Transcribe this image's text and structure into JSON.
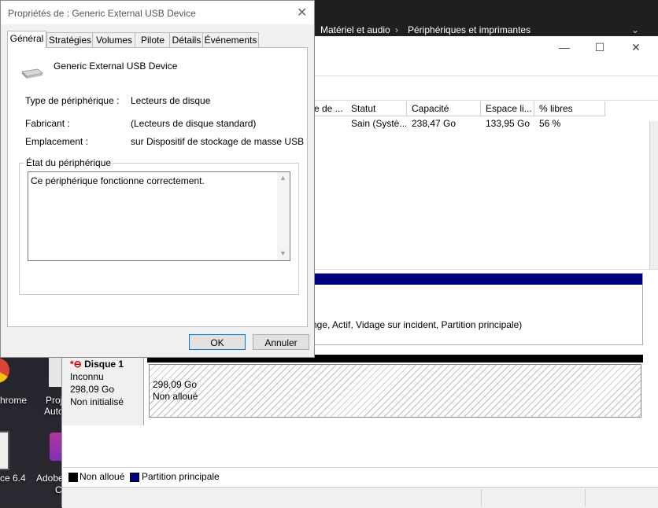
{
  "desktop": {
    "icons": [
      {
        "label": "hrome"
      },
      {
        "label": "Proj"
      },
      {
        "label": "Auto"
      },
      {
        "label": "ce 6.4"
      },
      {
        "label": "Adobe"
      },
      {
        "label": "C"
      }
    ]
  },
  "explorer": {
    "breadcrumb": [
      {
        "label": "Matériel et audio"
      },
      {
        "label": "Périphériques et imprimantes"
      }
    ]
  },
  "disk_management": {
    "window_buttons": {
      "minimize": "—",
      "maximize": "☐",
      "close": "✕"
    },
    "volume_table": {
      "columns": [
        "e de ...",
        "Statut",
        "Capacité",
        "Espace li...",
        "% libres"
      ],
      "rows": [
        {
          "type": "",
          "status": "Sain (Systè...",
          "capacity": "238,47 Go",
          "free": "133,95 Go",
          "percent": "56 %"
        }
      ]
    },
    "disk0_partition_text": "nge, Actif, Vidage sur incident, Partition principale)",
    "disk1": {
      "name": "Disque 1",
      "type": "Inconnu",
      "size": "298,09 Go",
      "state": "Non initialisé",
      "partition_size": "298,09 Go",
      "partition_state": "Non alloué"
    },
    "legend": [
      {
        "label": "Non alloué",
        "color": "#000000"
      },
      {
        "label": "Partition principale",
        "color": "#00007f"
      }
    ]
  },
  "dialog": {
    "title": "Propriétés de : Generic External USB Device",
    "close_glyph": "✕",
    "tabs": [
      {
        "label": "Général"
      },
      {
        "label": "Stratégies"
      },
      {
        "label": "Volumes"
      },
      {
        "label": "Pilote"
      },
      {
        "label": "Détails"
      },
      {
        "label": "Événements"
      }
    ],
    "device_name": "Generic External USB Device",
    "properties": [
      {
        "label": "Type de périphérique :",
        "value": "Lecteurs de disque"
      },
      {
        "label": "Fabricant :",
        "value": "(Lecteurs de disque standard)"
      },
      {
        "label": "Emplacement :",
        "value": "sur Dispositif de stockage de masse USB"
      }
    ],
    "status_group_title": "État du périphérique",
    "status_text": "Ce périphérique fonctionne correctement.",
    "ok_label": "OK",
    "cancel_label": "Annuler"
  }
}
